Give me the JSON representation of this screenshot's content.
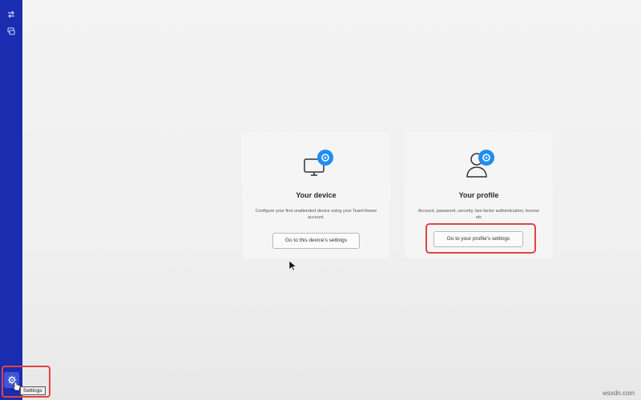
{
  "sidebar": {
    "top_icons": [
      "swap-arrows-icon",
      "remote-chat-icon"
    ],
    "settings_icon": "gear-icon",
    "settings_tooltip": "Settings",
    "brand_color": "#1a2cb0"
  },
  "cards": {
    "device": {
      "icon": "monitor-gear-icon",
      "title": "Your device",
      "description": "Configure your first unattended device using your TeamViewer account.",
      "button_label": "Go to this device's settings"
    },
    "profile": {
      "icon": "user-gear-icon",
      "title": "Your profile",
      "description": "Account, password, security, two-factor authentication, license etc",
      "button_label": "Go to your profile's settings"
    }
  },
  "highlight_color": "#e0463f",
  "watermark": "wsxdn.com"
}
